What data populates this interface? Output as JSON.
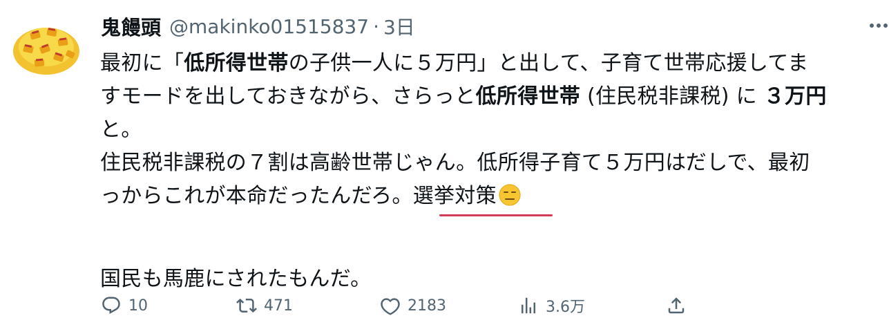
{
  "tweet": {
    "author": {
      "display_name": "鬼饅頭",
      "handle": "@makinko01515837",
      "separator": "·",
      "time": "3日"
    },
    "body": {
      "l1_a": "最初に「",
      "l1_b": "低所得世帯",
      "l1_c": "の子供一人に５万円」と出して、子育て世帯応援してま",
      "l2_a": "すモードを出しておきながら、さらっと",
      "l2_b": "低所得世帯",
      "l2_c": " (住民税非課税) に ",
      "l2_d": "３万円",
      "l3": "と。",
      "l4": "住民税非課税の７割は高齢世帯じゃん。低所得子育て５万円はだしで、最初",
      "l5_a": "っからこれが本命だったんだろ。",
      "l5_b": "選挙対策",
      "l6": "国民も馬鹿にされたもんだ。"
    },
    "emoji": "expressionless-face-emoji",
    "actions": {
      "reply_count": "10",
      "retweet_count": "471",
      "like_count": "2183",
      "view_count": "3.6万"
    },
    "colors": {
      "text": "#0f1419",
      "secondary": "#536471",
      "underline": "#d33a55"
    }
  }
}
